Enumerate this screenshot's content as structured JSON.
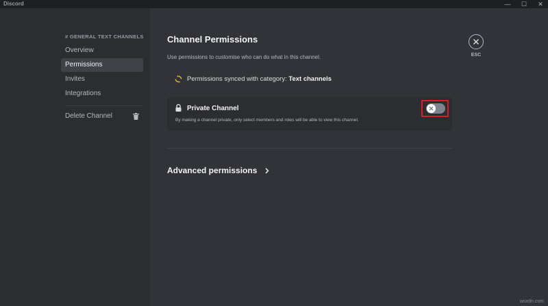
{
  "window": {
    "app_name": "Discord",
    "controls": {
      "minimize": "—",
      "maximize": "☐",
      "close": "✕"
    }
  },
  "sidebar": {
    "header": "# GENERAL TEXT CHANNELS",
    "items": [
      {
        "label": "Overview",
        "selected": false
      },
      {
        "label": "Permissions",
        "selected": true
      },
      {
        "label": "Invites",
        "selected": false
      },
      {
        "label": "Integrations",
        "selected": false
      }
    ],
    "delete_label": "Delete Channel",
    "delete_icon": "trash-icon"
  },
  "main": {
    "title": "Channel Permissions",
    "description": "Use permissions to customise who can do what in this channel.",
    "sync": {
      "icon": "sync-icon",
      "text": "Permissions synced with category: ",
      "category": "Text channels"
    },
    "private_channel": {
      "icon": "lock-icon",
      "title": "Private Channel",
      "description": "By making a channel private, only select members and roles will be able to view this channel.",
      "toggle_on": false
    },
    "advanced": {
      "label": "Advanced permissions",
      "icon": "chevron-right-icon"
    }
  },
  "close": {
    "icon": "close-icon",
    "label": "ESC"
  },
  "watermark": "wsxdn.com",
  "colors": {
    "sidebar_bg": "#2b2d31",
    "main_bg": "#313338",
    "selected_bg": "#404249",
    "sync_icon": "#f0b232",
    "toggle_off": "#80848e",
    "highlight_border": "#e01b24"
  }
}
